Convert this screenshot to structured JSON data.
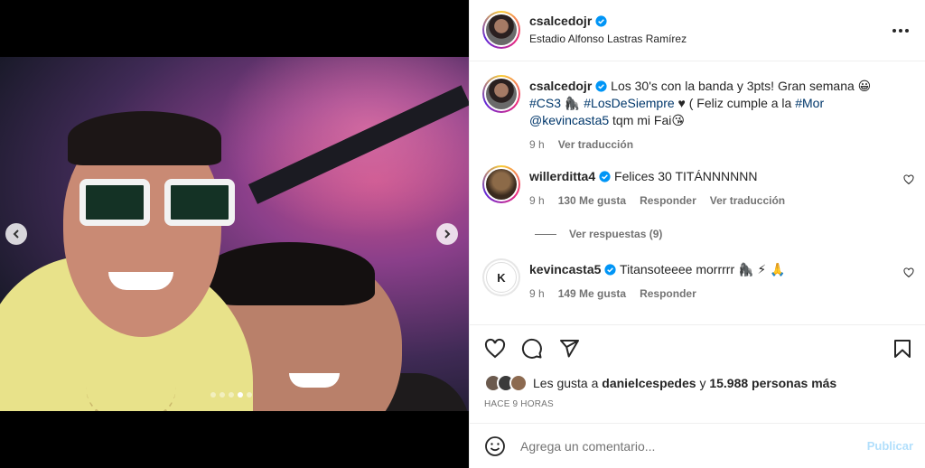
{
  "post": {
    "username": "csalcedojr",
    "location": "Estadio Alfonso Lastras Ramírez",
    "more_icon": "more-horizontal-icon",
    "slides": 5,
    "active_slide": 4
  },
  "caption": {
    "username": "csalcedojr",
    "text_1": "Los 30's con la banda y 3pts! Gran semana 😀",
    "tag_1": "#CS3",
    "emoji_1": "🦍",
    "tag_2": "#LosDeSiempre",
    "text_2": "♥ ( Feliz cumple a la",
    "tag_3": "#Mor",
    "mention": "@kevincasta5",
    "text_3": "tqm mi Fai😘",
    "time": "9 h",
    "translate": "Ver traducción"
  },
  "comments": [
    {
      "username": "willerditta4",
      "text": "Felices 30 TITÁNNNNNN",
      "time": "9 h",
      "likes": "130 Me gusta",
      "reply": "Responder",
      "translate": "Ver traducción",
      "replies": "Ver respuestas (9)"
    },
    {
      "username": "kevincasta5",
      "avatar_text": "K",
      "text": "Titansoteeee morrrrr 🦍 ⚡ 🙏",
      "time": "9 h",
      "likes": "149 Me gusta",
      "reply": "Responder"
    }
  ],
  "likes": {
    "prefix": "Les gusta a",
    "user": "danielcespedes",
    "connector": "y",
    "count": "15.988 personas más"
  },
  "timestamp": "HACE 9 HORAS",
  "comment_box": {
    "placeholder": "Agrega un comentario...",
    "publish": "Publicar"
  },
  "colors": {
    "link": "#00376b",
    "verified": "#0095f6",
    "muted": "#737373",
    "publish_disabled": "#b2dffc"
  }
}
